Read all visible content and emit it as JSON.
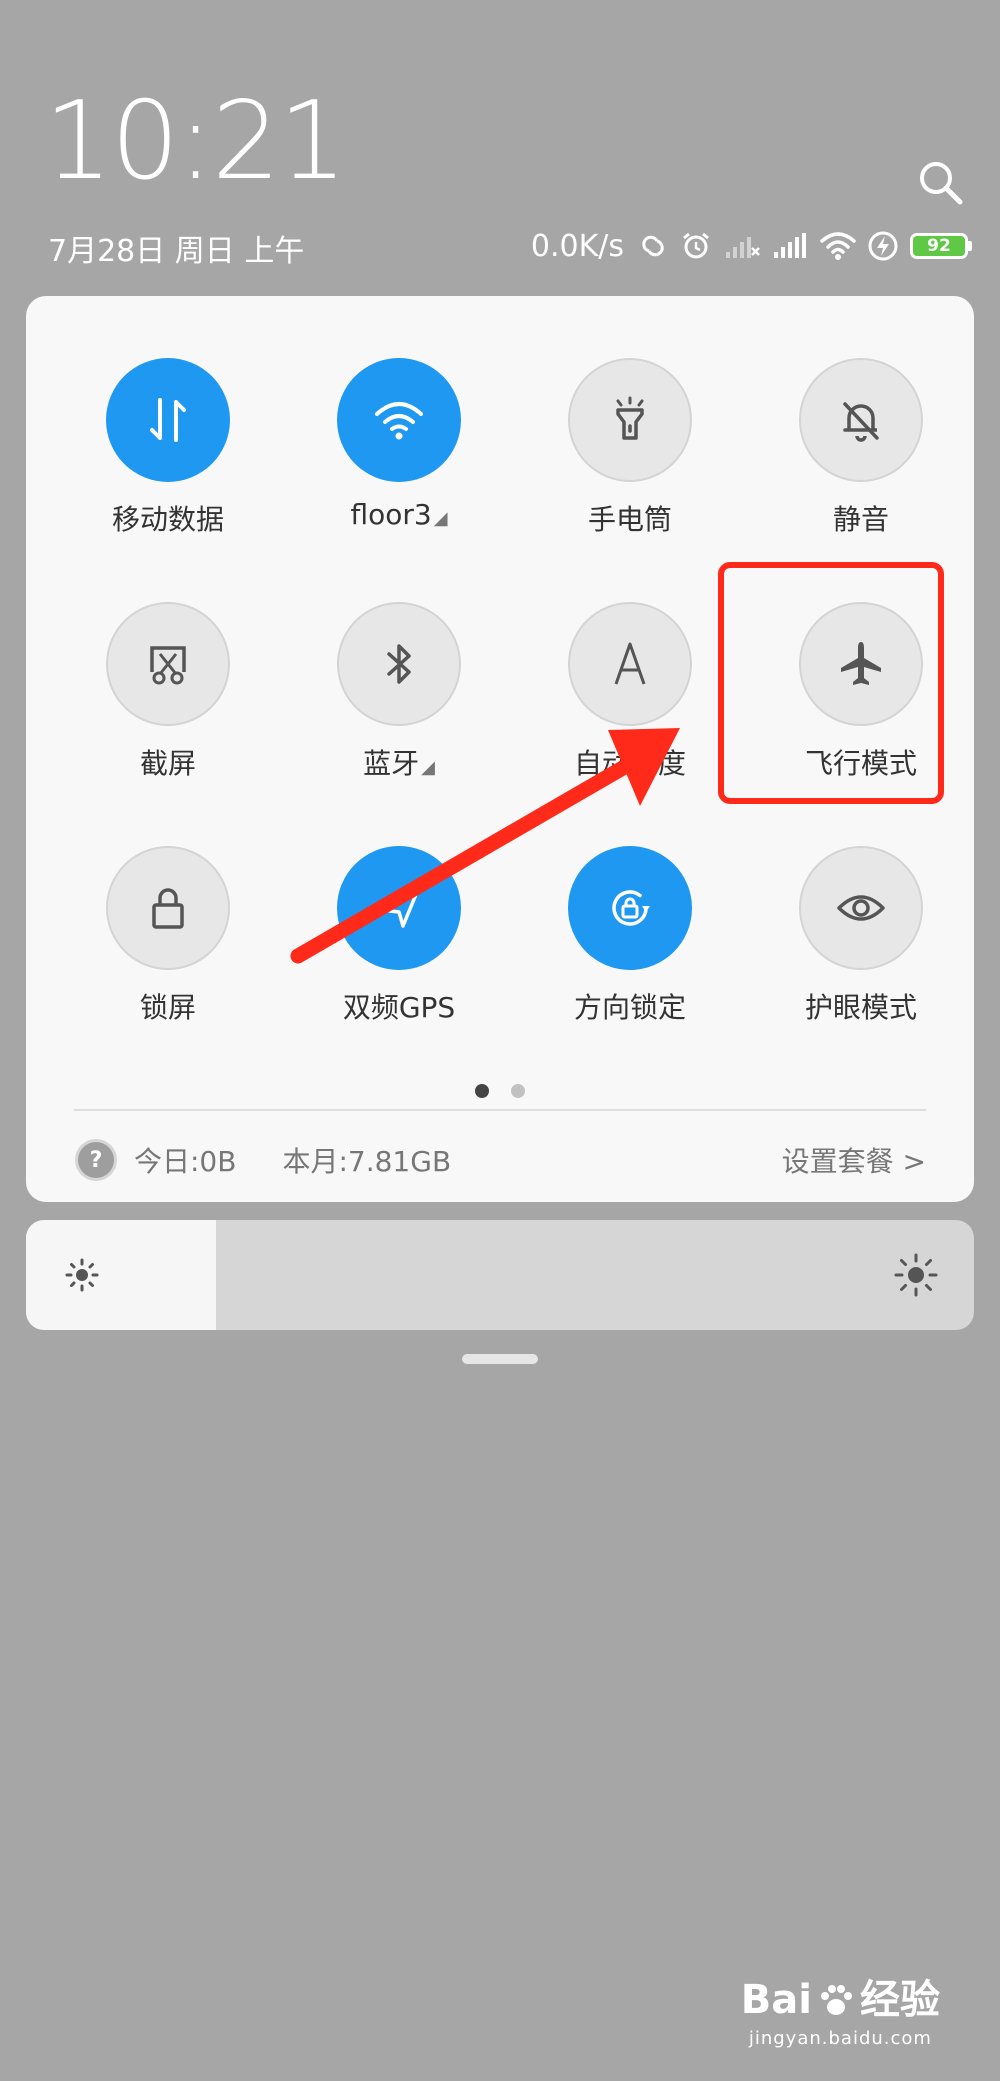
{
  "status_bar": {
    "time": "10:21",
    "date": "7月28日 周日 上午",
    "net_speed": "0.0K/s",
    "battery_level": "92",
    "icons": [
      "hotspot-icon",
      "alarm-icon",
      "signal-no-service-icon",
      "signal-icon",
      "wifi-icon",
      "charging-icon",
      "battery-icon"
    ]
  },
  "search": {
    "icon": "search-icon"
  },
  "quick_settings": {
    "tiles": [
      {
        "label": "移动数据",
        "icon": "mobile-data-icon",
        "state": "on"
      },
      {
        "label": "floor3",
        "icon": "wifi-icon",
        "state": "on",
        "has_more": true
      },
      {
        "label": "手电筒",
        "icon": "flashlight-icon",
        "state": "off"
      },
      {
        "label": "静音",
        "icon": "bell-off-icon",
        "state": "off"
      },
      {
        "label": "截屏",
        "icon": "screenshot-icon",
        "state": "off"
      },
      {
        "label": "蓝牙",
        "icon": "bluetooth-icon",
        "state": "off",
        "has_more": true
      },
      {
        "label": "自动亮度",
        "icon": "auto-brightness-icon",
        "state": "off"
      },
      {
        "label": "飞行模式",
        "icon": "airplane-icon",
        "state": "off"
      },
      {
        "label": "锁屏",
        "icon": "lock-icon",
        "state": "off"
      },
      {
        "label": "双频GPS",
        "icon": "gps-icon",
        "state": "on"
      },
      {
        "label": "方向锁定",
        "icon": "rotation-lock-icon",
        "state": "on"
      },
      {
        "label": "护眼模式",
        "icon": "eye-icon",
        "state": "off"
      }
    ],
    "page_count": 2,
    "current_page": 1
  },
  "data_usage": {
    "today": "今日:0B",
    "month": "本月:7.81GB",
    "plan_link": "设置套餐 >"
  },
  "brightness": {
    "level": 0.2
  },
  "watermark": {
    "brand": "Bai",
    "brand_cn": "经验",
    "url": "jingyan.baidu.com"
  },
  "colors": {
    "accent": "#1f98f2",
    "highlight": "#ff2a1a",
    "background": "#a6a6a6",
    "panel": "#f8f8f8"
  }
}
